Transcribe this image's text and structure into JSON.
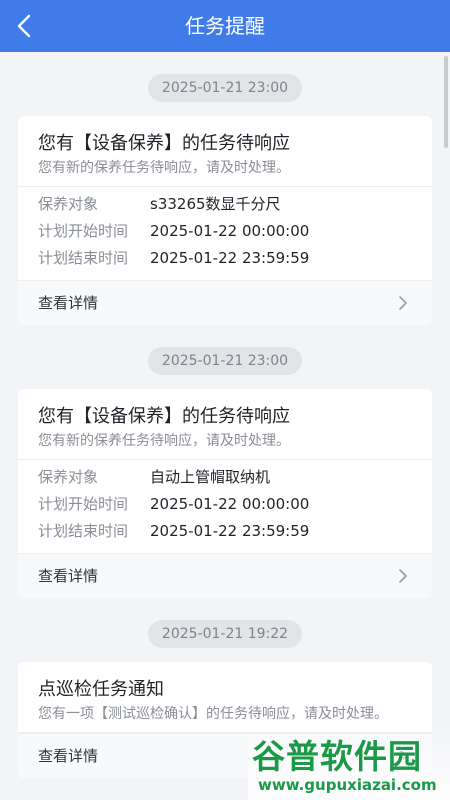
{
  "header": {
    "title": "任务提醒"
  },
  "notifications": [
    {
      "timestamp": "2025-01-21 23:00",
      "title": "您有【设备保养】的任务待响应",
      "description": "您有新的保养任务待响应，请及时处理。",
      "fields": [
        {
          "label": "保养对象",
          "value": "s33265数显千分尺"
        },
        {
          "label": "计划开始时间",
          "value": "2025-01-22 00:00:00"
        },
        {
          "label": "计划结束时间",
          "value": "2025-01-22 23:59:59"
        }
      ],
      "link": "查看详情"
    },
    {
      "timestamp": "2025-01-21 23:00",
      "title": "您有【设备保养】的任务待响应",
      "description": "您有新的保养任务待响应，请及时处理。",
      "fields": [
        {
          "label": "保养对象",
          "value": "自动上管帽取纳机"
        },
        {
          "label": "计划开始时间",
          "value": "2025-01-22 00:00:00"
        },
        {
          "label": "计划结束时间",
          "value": "2025-01-22 23:59:59"
        }
      ],
      "link": "查看详情"
    },
    {
      "timestamp": "2025-01-21 19:22",
      "title": "点巡检任务通知",
      "description": "您有一项【测试巡检确认】的任务待响应，请及时处理。",
      "link": "查看详情"
    }
  ],
  "watermark": {
    "logo": "谷普软件园",
    "url": "www.gupuxiazai.com"
  },
  "colors": {
    "accent": "#3f7be9",
    "background": "#f3f4f8",
    "watermark": "#1a9a46"
  },
  "icons": {
    "back": "chevron-left-icon",
    "detail": "chevron-right-icon"
  }
}
